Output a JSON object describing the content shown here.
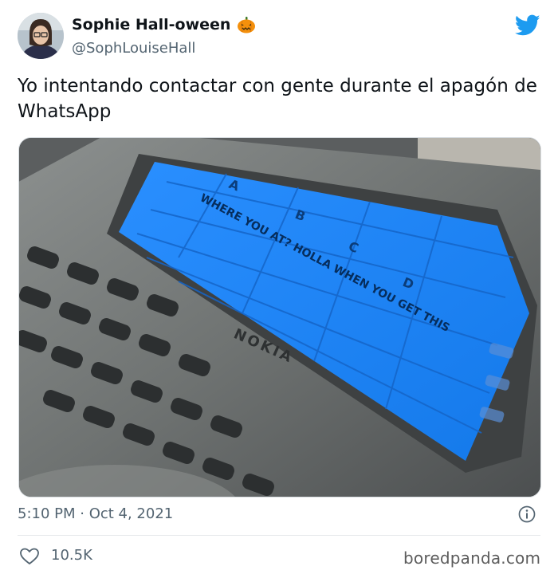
{
  "author": {
    "display_name": "Sophie Hall-oween",
    "handle": "@SophLouiseHall",
    "name_emoji": "pumpkin-icon",
    "avatar": "avatar"
  },
  "tweet": {
    "text": "Yo intentando contactar con gente durante el apagón de WhatsApp",
    "timestamp": "5:10 PM · Oct 4, 2021",
    "likes": "10.5K"
  },
  "media": {
    "screen_columns": [
      "A",
      "B",
      "C",
      "D"
    ],
    "screen_message": "WHERE YOU AT? HOLLA WHEN YOU GET THIS",
    "device_brand": "NOKIA"
  },
  "footer": {
    "watermark": "boredpanda.com"
  },
  "icons": {
    "platform": "twitter-bird-icon",
    "info": "info-icon",
    "like": "heart-icon"
  },
  "colors": {
    "brand": "#1d9bf0",
    "text_primary": "#0f1419",
    "text_secondary": "#536471",
    "screen_blue": "#1e8cff"
  }
}
